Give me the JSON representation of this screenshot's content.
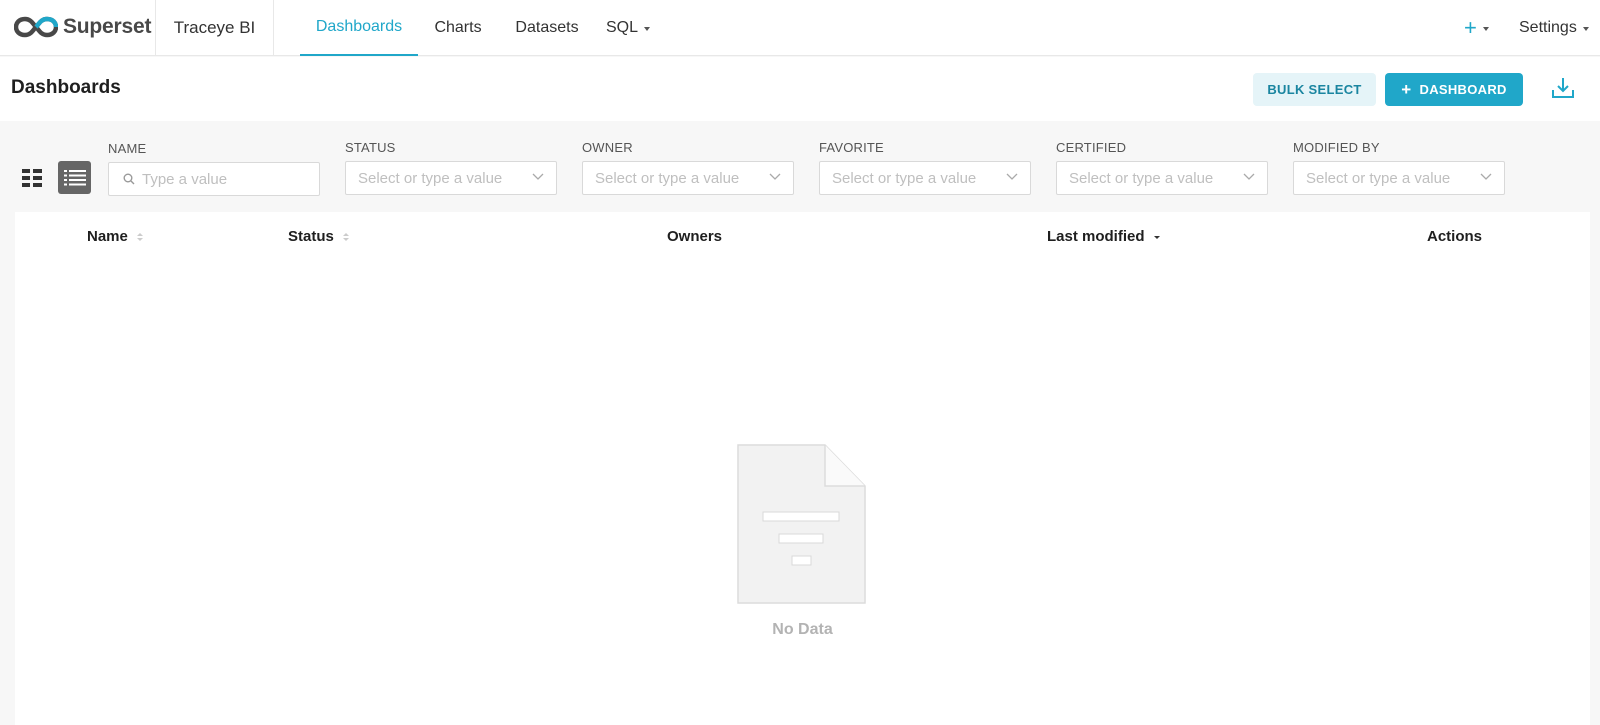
{
  "brand": {
    "logo_text": "Superset",
    "workspace": "Traceye BI"
  },
  "nav": {
    "items": [
      {
        "label": "Dashboards",
        "active": true
      },
      {
        "label": "Charts",
        "active": false
      },
      {
        "label": "Datasets",
        "active": false
      },
      {
        "label": "SQL",
        "active": false,
        "dropdown": true
      }
    ],
    "plus_label": "+",
    "settings_label": "Settings"
  },
  "header": {
    "title": "Dashboards",
    "bulk_select_label": "BULK SELECT",
    "add_dashboard_label": "DASHBOARD",
    "add_icon": "+"
  },
  "filters": [
    {
      "label": "NAME",
      "placeholder": "Type a value",
      "type": "search"
    },
    {
      "label": "STATUS",
      "placeholder": "Select or type a value",
      "type": "select"
    },
    {
      "label": "OWNER",
      "placeholder": "Select or type a value",
      "type": "select"
    },
    {
      "label": "FAVORITE",
      "placeholder": "Select or type a value",
      "type": "select"
    },
    {
      "label": "CERTIFIED",
      "placeholder": "Select or type a value",
      "type": "select"
    },
    {
      "label": "MODIFIED BY",
      "placeholder": "Select or type a value",
      "type": "select"
    }
  ],
  "table": {
    "columns": [
      {
        "label": "Name",
        "sortable": true,
        "sort": "none"
      },
      {
        "label": "Status",
        "sortable": true,
        "sort": "none"
      },
      {
        "label": "Owners",
        "sortable": false
      },
      {
        "label": "Last modified",
        "sortable": true,
        "sort": "desc"
      },
      {
        "label": "Actions",
        "sortable": false
      }
    ],
    "rows": [],
    "empty_text": "No Data"
  },
  "colors": {
    "accent": "#20a7c9",
    "accent_light": "#e5f4f8",
    "toggle_active": "#666666"
  }
}
